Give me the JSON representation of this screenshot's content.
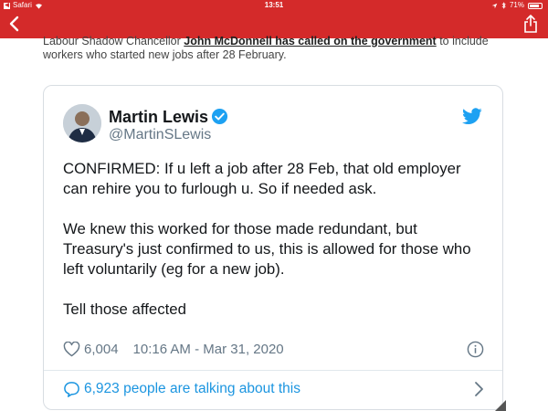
{
  "status_bar": {
    "back_app": "Safari",
    "time": "13:51",
    "battery": "71%"
  },
  "colors": {
    "header_red": "#d42a2a",
    "twitter_blue": "#1da1f2",
    "link_blue": "#1b95e0",
    "muted_gray": "#657786"
  },
  "icons": {
    "back": "chevron-left-icon",
    "share": "share-icon",
    "verified": "verified-badge-icon",
    "twitter": "twitter-bird-icon",
    "like": "heart-icon",
    "info": "info-icon",
    "talking": "speech-bubble-icon",
    "more": "chevron-right-icon"
  },
  "article": {
    "pre": "Labour Shadow Chancellor ",
    "link": "John McDonnell has called on the government",
    "post": " to include workers who started new jobs after 28 February."
  },
  "tweet": {
    "display_name": "Martin Lewis",
    "handle": "@MartinSLewis",
    "paragraphs": [
      "CONFIRMED: If u left a job after 28 Feb, that old employer can rehire you to furlough u. So if needed ask.",
      "We knew this worked for those made redundant, but Treasury's just confirmed to us, this is allowed for those who left voluntarily (eg for a new job).",
      "Tell those affected"
    ],
    "likes": "6,004",
    "timestamp": "10:16 AM - Mar 31, 2020",
    "talking": "6,923 people are talking about this"
  }
}
